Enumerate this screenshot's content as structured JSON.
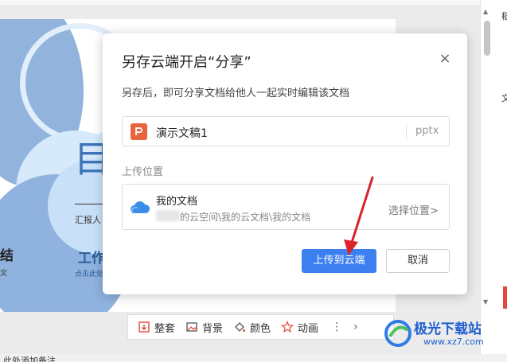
{
  "dialog": {
    "title": "另存云端开启“分享”",
    "description": "另存后，即可分享文档给他人一起实时编辑该文档",
    "file": {
      "name": "演示文稿1",
      "extension": "pptx",
      "icon": "ppt-file-icon",
      "icon_color": "#e8643c"
    },
    "location": {
      "label": "上传位置",
      "name": "我的文档",
      "path": "的云空间\\我的云文档\\我的文档",
      "choose_label": "选择位置>",
      "icon": "cloud-icon"
    },
    "upload_button": "上传到云端",
    "cancel_button": "取消",
    "close_icon": "×",
    "accent_color": "#3b7ff0"
  },
  "slide": {
    "title": "目",
    "reporter_label": "汇报人",
    "left_bold": "结",
    "left_small": "文",
    "work_label": "工作",
    "click_hint": "点击此处"
  },
  "toolbar": {
    "items": [
      {
        "label": "整套",
        "icon": "template-set-icon"
      },
      {
        "label": "背景",
        "icon": "background-image-icon"
      },
      {
        "label": "颜色",
        "icon": "paint-bucket-icon"
      },
      {
        "label": "动画",
        "icon": "star-animation-icon"
      }
    ],
    "more": "⋮",
    "next": "›"
  },
  "right_pane": {
    "top_text": "稻",
    "mid_text": "文"
  },
  "status_bar": {
    "text": "此处添加备注"
  },
  "watermark": {
    "text": "极光下载站",
    "url": "www.xz7.com"
  }
}
